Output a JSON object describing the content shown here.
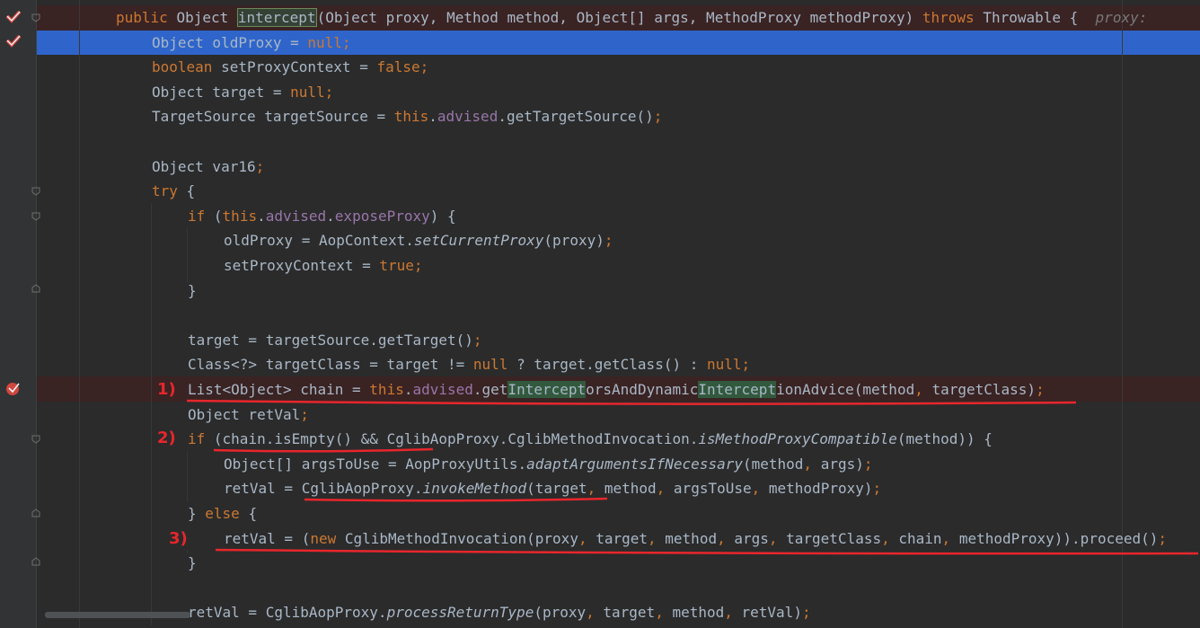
{
  "code_lines": [
    {
      "id": "line-intercept-signature",
      "parts": [
        {
          "t": "public ",
          "c": "k"
        },
        {
          "t": "Object "
        },
        {
          "t": "intercept",
          "c": "hl2"
        },
        {
          "t": "(Object proxy, Method method, Object[] args, MethodProxy methodProxy) "
        },
        {
          "t": "throws ",
          "c": "k"
        },
        {
          "t": "Throwable {  "
        },
        {
          "t": "proxy: ",
          "c": "hint"
        }
      ]
    },
    {
      "id": "line-old-proxy",
      "parts": [
        {
          "t": "Object oldProxy = "
        },
        {
          "t": "null",
          "c": "k"
        },
        {
          "t": ";",
          "c": "k"
        }
      ]
    },
    {
      "id": "line-set-proxy-context",
      "parts": [
        {
          "t": "boolean ",
          "c": "k"
        },
        {
          "t": "setProxyContext = "
        },
        {
          "t": "false",
          "c": "k"
        },
        {
          "t": ";",
          "c": "k"
        }
      ]
    },
    {
      "id": "line-target-decl",
      "parts": [
        {
          "t": "Object target = "
        },
        {
          "t": "null",
          "c": "k"
        },
        {
          "t": ";",
          "c": "k"
        }
      ]
    },
    {
      "id": "line-target-source",
      "parts": [
        {
          "t": "TargetSource targetSource = "
        },
        {
          "t": "this",
          "c": "k"
        },
        {
          "t": "."
        },
        {
          "t": "advised",
          "c": "f"
        },
        {
          "t": ".getTargetSource()"
        },
        {
          "t": ";",
          "c": "k"
        }
      ]
    },
    {
      "id": "line-blank-1",
      "parts": []
    },
    {
      "id": "line-var16",
      "parts": [
        {
          "t": "Object var16"
        },
        {
          "t": ";",
          "c": "k"
        }
      ]
    },
    {
      "id": "line-try",
      "parts": [
        {
          "t": "try ",
          "c": "k"
        },
        {
          "t": "{"
        }
      ]
    },
    {
      "id": "line-if-expose-proxy",
      "parts": [
        {
          "t": "if ",
          "c": "k"
        },
        {
          "t": "("
        },
        {
          "t": "this",
          "c": "k"
        },
        {
          "t": "."
        },
        {
          "t": "advised",
          "c": "f"
        },
        {
          "t": "."
        },
        {
          "t": "exposeProxy",
          "c": "f"
        },
        {
          "t": ") {"
        }
      ]
    },
    {
      "id": "line-set-current-proxy",
      "parts": [
        {
          "t": "oldProxy = AopContext."
        },
        {
          "t": "setCurrentProxy",
          "c": "it"
        },
        {
          "t": "(proxy)"
        },
        {
          "t": ";",
          "c": "k"
        }
      ]
    },
    {
      "id": "line-set-proxy-context-true",
      "parts": [
        {
          "t": "setProxyContext = "
        },
        {
          "t": "true",
          "c": "k"
        },
        {
          "t": ";",
          "c": "k"
        }
      ]
    },
    {
      "id": "line-close-if-1",
      "parts": [
        {
          "t": "}"
        }
      ]
    },
    {
      "id": "line-blank-2",
      "parts": []
    },
    {
      "id": "line-get-target",
      "parts": [
        {
          "t": "target = targetSource.getTarget()"
        },
        {
          "t": ";",
          "c": "k"
        }
      ]
    },
    {
      "id": "line-target-class",
      "parts": [
        {
          "t": "Class<?> targetClass = target != "
        },
        {
          "t": "null ",
          "c": "k"
        },
        {
          "t": "? target.getClass() : "
        },
        {
          "t": "null",
          "c": "k"
        },
        {
          "t": ";",
          "c": "k"
        }
      ]
    },
    {
      "id": "line-chain",
      "parts": [
        {
          "t": "List<Object> chain = "
        },
        {
          "t": "this",
          "c": "k"
        },
        {
          "t": "."
        },
        {
          "t": "advised",
          "c": "f"
        },
        {
          "t": ".get"
        },
        {
          "t": "Intercept",
          "c": "hl"
        },
        {
          "t": "orsAndDynamic"
        },
        {
          "t": "Intercept",
          "c": "hl"
        },
        {
          "t": "ionAdvice(method"
        },
        {
          "t": ", ",
          "c": "k"
        },
        {
          "t": "targetClass)"
        },
        {
          "t": ";",
          "c": "k"
        }
      ]
    },
    {
      "id": "line-retval-decl",
      "parts": [
        {
          "t": "Object retVal"
        },
        {
          "t": ";",
          "c": "k"
        }
      ]
    },
    {
      "id": "line-if-chain-empty",
      "parts": [
        {
          "t": "if ",
          "c": "k"
        },
        {
          "t": "(chain.isEmpty() && CglibAopProxy.CglibMethodInvocation."
        },
        {
          "t": "isMethodProxyCompatible",
          "c": "it"
        },
        {
          "t": "(method)) {"
        }
      ]
    },
    {
      "id": "line-args-to-use",
      "parts": [
        {
          "t": "Object[] argsToUse = AopProxyUtils."
        },
        {
          "t": "adaptArgumentsIfNecessary",
          "c": "it"
        },
        {
          "t": "(method"
        },
        {
          "t": ", ",
          "c": "k"
        },
        {
          "t": "args)"
        },
        {
          "t": ";",
          "c": "k"
        }
      ]
    },
    {
      "id": "line-invoke-method",
      "parts": [
        {
          "t": "retVal = CglibAopProxy."
        },
        {
          "t": "invokeMethod",
          "c": "it"
        },
        {
          "t": "(target"
        },
        {
          "t": ", ",
          "c": "k"
        },
        {
          "t": "method"
        },
        {
          "t": ", ",
          "c": "k"
        },
        {
          "t": "argsToUse"
        },
        {
          "t": ", ",
          "c": "k"
        },
        {
          "t": "methodProxy)"
        },
        {
          "t": ";",
          "c": "k"
        }
      ]
    },
    {
      "id": "line-else",
      "parts": [
        {
          "t": "} "
        },
        {
          "t": "else ",
          "c": "k"
        },
        {
          "t": "{"
        }
      ]
    },
    {
      "id": "line-proceed",
      "parts": [
        {
          "t": "retVal = ("
        },
        {
          "t": "new ",
          "c": "k"
        },
        {
          "t": "CglibMethodInvocation(proxy"
        },
        {
          "t": ", ",
          "c": "k"
        },
        {
          "t": "target"
        },
        {
          "t": ", ",
          "c": "k"
        },
        {
          "t": "method"
        },
        {
          "t": ", ",
          "c": "k"
        },
        {
          "t": "args"
        },
        {
          "t": ", ",
          "c": "k"
        },
        {
          "t": "targetClass"
        },
        {
          "t": ", ",
          "c": "k"
        },
        {
          "t": "chain"
        },
        {
          "t": ", ",
          "c": "k"
        },
        {
          "t": "methodProxy)).proceed()"
        },
        {
          "t": ";",
          "c": "k"
        }
      ]
    },
    {
      "id": "line-close-else",
      "parts": [
        {
          "t": "}"
        }
      ]
    },
    {
      "id": "line-blank-3",
      "parts": []
    },
    {
      "id": "line-process-return-type",
      "parts": [
        {
          "t": "retVal = CglibAopProxy."
        },
        {
          "t": "processReturnType",
          "c": "it"
        },
        {
          "t": "(proxy"
        },
        {
          "t": ", ",
          "c": "k"
        },
        {
          "t": "target"
        },
        {
          "t": ", ",
          "c": "k"
        },
        {
          "t": "method"
        },
        {
          "t": ", ",
          "c": "k"
        },
        {
          "t": "retVal)"
        },
        {
          "t": ";",
          "c": "k"
        }
      ]
    }
  ],
  "annotations": {
    "label_1": "1)",
    "label_2": "2)",
    "label_3": "3)"
  },
  "colors": {
    "background": "#2b2b2b",
    "text": "#a9b7c6",
    "keyword": "#cc7832",
    "field": "#9876aa",
    "selection": "#2f65ca",
    "breakpoint_line": "#3a2323",
    "annotation": "#e8262c"
  }
}
